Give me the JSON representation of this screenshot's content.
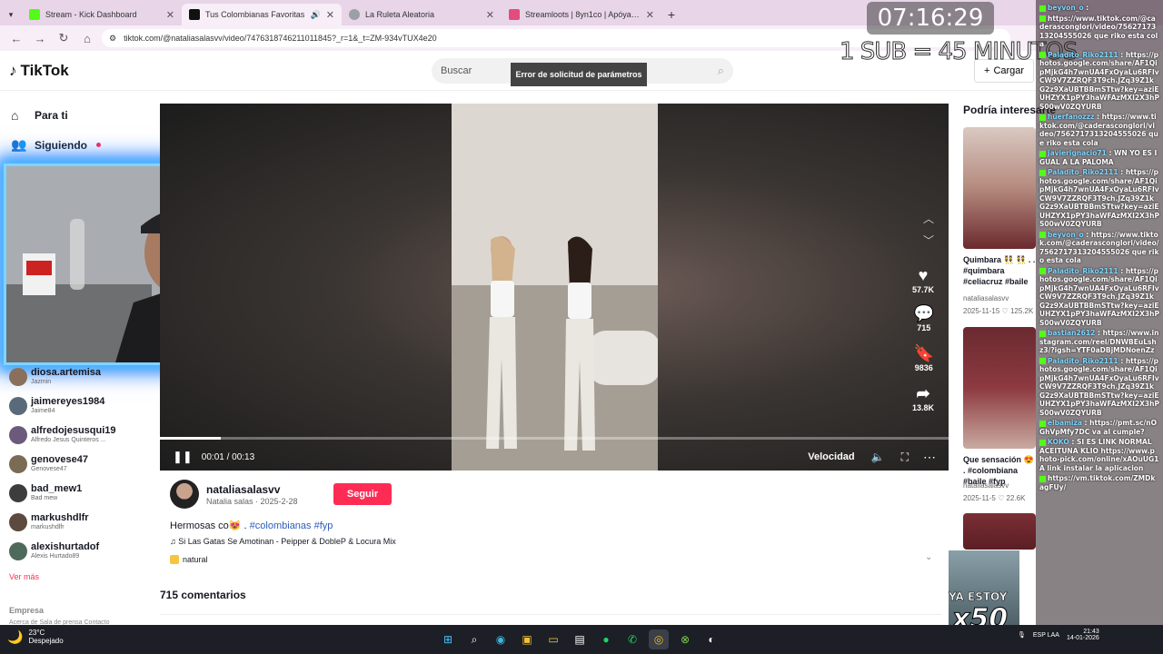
{
  "browser": {
    "tabs": [
      {
        "title": "Stream - Kick Dashboard",
        "color": "#53fc18",
        "active": false
      },
      {
        "title": "Tus Colombianas Favoritas",
        "color": "#111111",
        "active": true
      },
      {
        "title": "La Ruleta Aleatoria",
        "color": "#9aa0a6",
        "active": false
      },
      {
        "title": "Streamloots | 8yn1co | Apóyame",
        "color": "#e34c7c",
        "active": false
      }
    ],
    "url": "tiktok.com/@nataliasalasvv/video/7476318746211011845?_r=1&_t=ZM-934vTUX4e20"
  },
  "header": {
    "logo": "TikTok",
    "search_placeholder": "Buscar",
    "error_tooltip": "Error de solicitud de parámetros",
    "upload_label": "Cargar"
  },
  "sidebar": {
    "nav": [
      {
        "label": "Para ti",
        "icon": "home-icon"
      },
      {
        "label": "Siguiendo",
        "icon": "following-icon"
      }
    ],
    "accounts": [
      {
        "name": "diosa.artemisa",
        "sub": "Jazmin",
        "color": "#8a6f5a"
      },
      {
        "name": "jaimereyes1984",
        "sub": "Jaime84",
        "color": "#5a6a7a"
      },
      {
        "name": "alfredojesusqui19",
        "sub": "Alfredo Jesus Quinteros ...",
        "color": "#6b5a7b"
      },
      {
        "name": "genovese47",
        "sub": "Genovese47",
        "color": "#7a6b55"
      },
      {
        "name": "bad_mew1",
        "sub": "Bad mew",
        "color": "#3d3d3d"
      },
      {
        "name": "markushdlfr",
        "sub": "markushdlfr",
        "color": "#5c4a3e"
      },
      {
        "name": "alexishurtadof",
        "sub": "Alexis Hurtado89",
        "color": "#4e6a5c"
      }
    ],
    "see_more": "Ver más",
    "company": "Empresa",
    "footer_links": "Acerca de  Sala de prensa  Contacto"
  },
  "video": {
    "likes": "57.7K",
    "comments": "715",
    "saves": "9836",
    "shares": "13.8K",
    "time": "00:01 / 00:13",
    "progress": 0.077,
    "speed_label": "Velocidad"
  },
  "post": {
    "author": "nataliasalasvv",
    "author_sub": "Natalia salas · 2025-2-28",
    "follow_label": "Seguir",
    "caption": "Hermosas co😻 .",
    "hashtags": "#colombianas #fyp",
    "music": "♫ Si Las Gatas Se Amotinan - Peipper & DobleP & Locura Mix",
    "effect": "natural",
    "comments_title": "715 comentarios"
  },
  "recommendations": {
    "title": "Podría interesarte",
    "items": [
      {
        "caption": "Quimbara 👯 👯 . . #quimbara #celiacruz #baile",
        "author": "nataliasalasvv",
        "meta": "2025-11-15  ♡ 125.2K"
      },
      {
        "caption": "Que sensación 😍 . #colombiana #baile #fyp",
        "author": "nataliasalasvv",
        "meta": "2025-11-5  ♡ 22.6K"
      }
    ]
  },
  "stream": {
    "timer": "07:16:29",
    "sub_rule": "1 SUB = 45 MINUTOS",
    "badge_text": "YA ESTOY",
    "badge_multiplier": "x50",
    "chat": [
      {
        "user": "beyvon_o",
        "msg": ""
      },
      {
        "user": "",
        "msg": "https://www.tiktok.com/@caderasconglori/video/7562717313204555026 que riko esta cola"
      },
      {
        "user": "Paladito_Riko2111",
        "msg": "https://photos.google.com/share/AF1QipMjkG4h7wnUA4FxOyaLu6RFIvCW9V7ZZRQF3T9ch.JZq39Z1kG2z9XaUBTBBmSTtw?key=aziEUHZYX1pPY3haWFAzMXI2X3hPS00wV0ZQYURB"
      },
      {
        "user": "huerfanozzz",
        "msg": "https://www.tiktok.com/@caderasconglori/video/7562717313204555026 que riko esta cola"
      },
      {
        "user": "javierignacio71",
        "msg": "WN YO ES IGUAL A LA PALOMA"
      },
      {
        "user": "Paladito_Riko2111",
        "msg": "https://photos.google.com/share/AF1QipMjkG4h7wnUA4FxOyaLu6RFIvCW9V7ZZRQF3T9ch.JZq39Z1kG2z9XaUBTBBmSTtw?key=aziEUHZYX1pPY3haWFAzMXI2X3hPS00wV0ZQYURB"
      },
      {
        "user": "beyvon_o",
        "msg": "https://www.tiktok.com/@caderasconglori/video/7562717313204555026 que riko esta cola"
      },
      {
        "user": "Paladito_Riko2111",
        "msg": "https://photos.google.com/share/AF1QipMjkG4h7wnUA4FxOyaLu6RFIvCW9V7ZZRQF3T9ch.JZq39Z1kG2z9XaUBTBBmSTtw?key=aziEUHZYX1pPY3haWFAzMXI2X3hPS00wV0ZQYURB"
      },
      {
        "user": "bastian2612",
        "msg": "https://www.instagram.com/reel/DNWBEuLshz3/?igsh=YTF0aDBjMDNoenZz"
      },
      {
        "user": "Paladito_Riko2111",
        "msg": "https://photos.google.com/share/AF1QipMjkG4h7wnUA4FxOyaLu6RFIvCW9V7ZZRQF3T9ch.JZq39Z1kG2z9XaUBTBBmSTtw?key=aziEUHZYX1pPY3haWFAzMXI2X3hPS00wV0ZQYURB"
      },
      {
        "user": "elbamiza",
        "msg": "https://pmt.sc/nOGhVpMfy7DC va al cumple?"
      },
      {
        "user": "KOKO",
        "msg": "SI ES LINK NORMAL ACEITUNA KLIO https://www.photo-pick.com/online/xAOuUG1A link instalar la aplicacion"
      },
      {
        "user": "",
        "msg": "https://vm.tiktok.com/ZMDkagFUy/"
      }
    ]
  },
  "taskbar": {
    "temperature": "23°C",
    "weather": "Despejado",
    "lang": "ESP LAA",
    "time": "21:43",
    "date": "14-01-2026"
  }
}
